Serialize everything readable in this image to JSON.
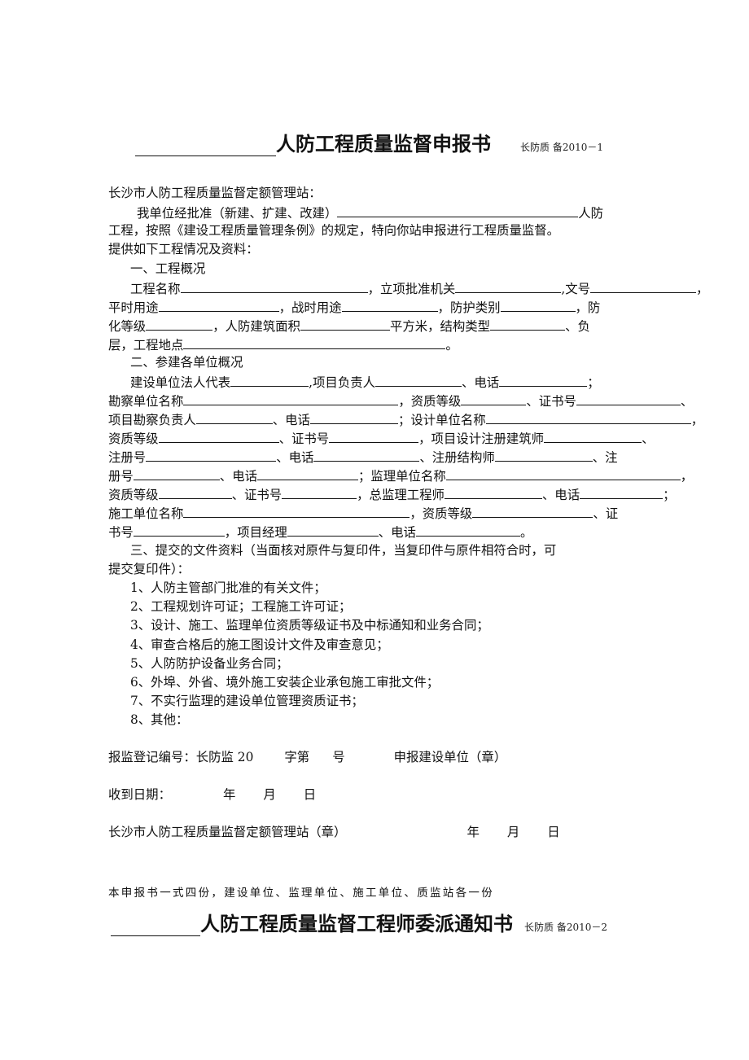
{
  "form1": {
    "title": "人防工程质量监督申报书",
    "code": "长防质 备2010－1",
    "addressee": "长沙市人防工程质量监督定额管理站：",
    "intro_a": "我单位经批准（新建、扩建、改建）",
    "intro_b": "人防",
    "intro_c": "工程，按照《建设工程质量管理条例》的规定，特向你站申报进行工程质量监督。",
    "intro_d": "提供如下工程情况及资料：",
    "section1": "一、工程概况",
    "s1": {
      "project_name": "工程名称",
      "approval_authority": "，立项批准机关",
      "doc_no": ",文号",
      "comma": "，",
      "peace_use": "平时用途",
      "war_use": "，战时用途",
      "protection_type": "，防护类别",
      "fang": "，防",
      "hua_grade": "化等级",
      "area": "，人防建筑面积",
      "sqm_structure": "平方米，结构类型",
      "fu": "、负",
      "ceng_location": "层，工程地点",
      "period": "。"
    },
    "section2": "二、参建各单位概况",
    "s2": {
      "l1_a": "建设单位法人代表",
      "l1_b": ",项目负责人",
      "l1_c": "、电话",
      "l1_d": "；",
      "l2_a": "勘察单位名称",
      "l2_b": "，资质等级",
      "l2_c": "、证书号",
      "l2_d": "、",
      "l3_a": "项目勘察负责人",
      "l3_b": "、电话",
      "l3_c": "；设计单位名称",
      "l3_d": "，",
      "l4_a": "资质等级",
      "l4_b": "、证书号",
      "l4_c": "，项目设计注册建筑师",
      "l4_d": "、",
      "l5_a": "注册号",
      "l5_b": "、电话",
      "l5_c": "、注册结构师",
      "l5_d": "、注",
      "l6_a": "册号",
      "l6_b": "、电话",
      "l6_c": "；监理单位名称",
      "l6_d": "，",
      "l7_a": "资质等级",
      "l7_b": "、证书号",
      "l7_c": "，总监理工程师",
      "l7_d": "、电话",
      "l7_e": "；",
      "l8_a": "施工单位名称",
      "l8_b": "，资质等级",
      "l8_c": "、证",
      "l9_a": "书号",
      "l9_b": "，项目经理",
      "l9_c": "、电话",
      "l9_d": "。"
    },
    "section3_a": "三、提交的文件资料（当面核对原件与复印件，当复印件与原件相符合时，可",
    "section3_b": "提交复印件）：",
    "documents": [
      "1、人防主管部门批准的有关文件；",
      "2、工程规划许可证；工程施工许可证；",
      "3、设计、施工、监理单位资质等级证书及中标通知和业务合同；",
      "4、审查合格后的施工图设计文件及审查意见；",
      "5、人防防护设备业务合同；",
      "6、外埠、外省、境外施工安装企业承包施工审批文件；",
      "7、不实行监理的建设单位管理资质证书；",
      "8、其他："
    ],
    "registration": {
      "label": "报监登记编号：长防监 20",
      "zi_di": "字第",
      "hao": "号",
      "applicant": "申报建设单位（章）"
    },
    "received": {
      "label": "收到日期：",
      "year": "年",
      "month": "月",
      "day": "日"
    },
    "station": {
      "label": "长沙市人防工程质量监督定额管理站（章）",
      "year": "年",
      "month": "月",
      "day": "日"
    },
    "note": "本申报书一式四份，建设单位、监理单位、施工单位、质监站各一份"
  },
  "form2": {
    "title": "人防工程质量监督工程师委派通知书",
    "code": "长防质 备2010－2"
  }
}
